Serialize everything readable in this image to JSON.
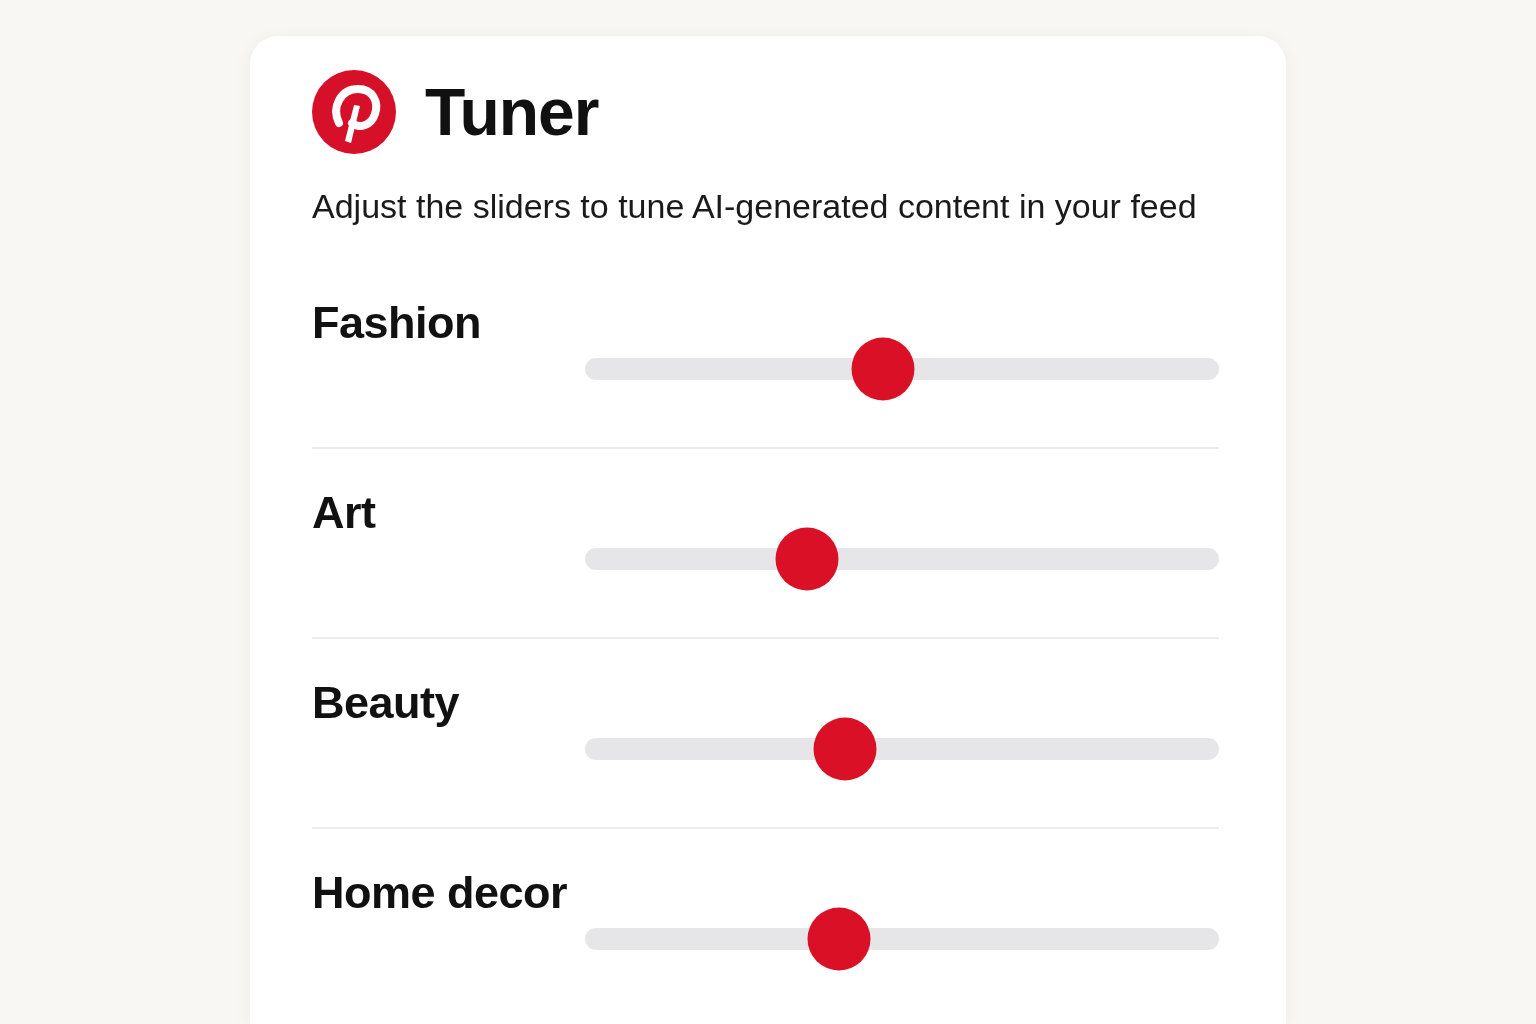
{
  "header": {
    "title": "Tuner",
    "subtitle": "Adjust the sliders to tune AI-generated content in your feed"
  },
  "sliders": [
    {
      "label": "Fashion",
      "level": 0.47
    },
    {
      "label": "Art",
      "level": 0.35
    },
    {
      "label": "Beauty",
      "level": 0.41
    },
    {
      "label": "Home decor",
      "level": 0.4
    }
  ]
}
